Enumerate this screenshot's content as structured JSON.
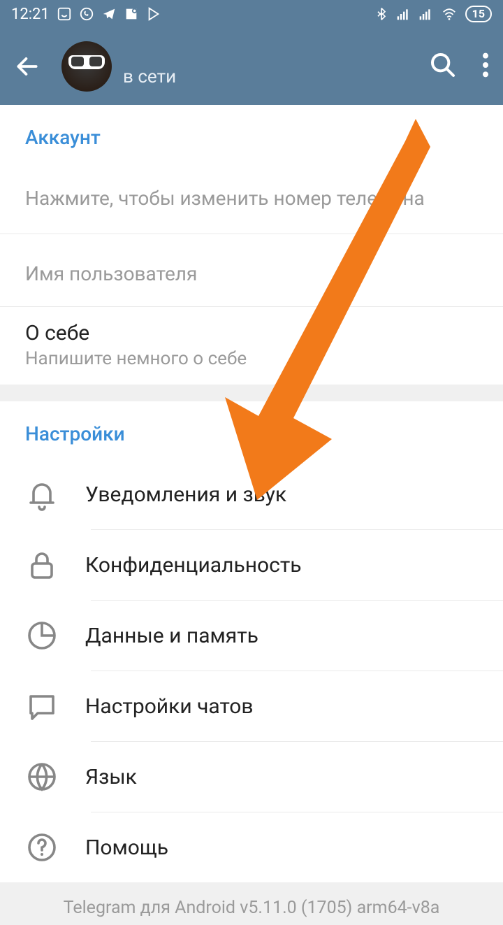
{
  "statusbar": {
    "time": "12:21",
    "battery": "15"
  },
  "header": {
    "status": "в сети"
  },
  "account": {
    "section_title": "Аккаунт",
    "phone_placeholder": "Нажмите, чтобы изменить номер телефона",
    "username_label": "Имя пользователя",
    "bio_title": "О себе",
    "bio_placeholder": "Напишите немного о себе"
  },
  "settings": {
    "section_title": "Настройки",
    "items": [
      {
        "label": "Уведомления и звук"
      },
      {
        "label": "Конфиденциальность"
      },
      {
        "label": "Данные и память"
      },
      {
        "label": "Настройки чатов"
      },
      {
        "label": "Язык"
      },
      {
        "label": "Помощь"
      }
    ]
  },
  "footer": {
    "version": "Telegram для Android v5.11.0 (1705) arm64-v8a"
  },
  "colors": {
    "header_bg": "#5a7d9a",
    "accent": "#3a8ed8",
    "arrow": "#f27a1a"
  }
}
